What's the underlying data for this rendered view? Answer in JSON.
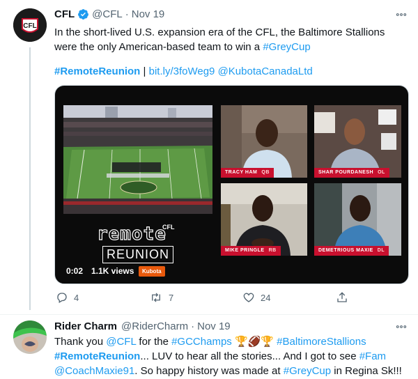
{
  "tweet1": {
    "author_name": "CFL",
    "verified": true,
    "handle": "@CFL",
    "separator": "·",
    "date": "Nov 19",
    "text_part1": "In the short-lived U.S. expansion era of the CFL, the Baltimore Stallions were the only American-based team to win a ",
    "hashtag_greycup": "#GreyCup",
    "hashtag_remote": "#RemoteReunion",
    "divider": "|",
    "link_text": "bit.ly/3foWeg9",
    "mention_kubota": "@KubotaCanadaLtd",
    "more_icon": "more-horizontal-icon",
    "video": {
      "overlay_title_top": "remote",
      "overlay_title_badge": "CFL",
      "overlay_title_bottom": "REUNION",
      "time": "0:02",
      "views": "1.1K views",
      "sponsor": "Kubota",
      "players": [
        {
          "name": "TRACY HAM",
          "position": "QB"
        },
        {
          "name": "SHAR POURDANESH",
          "position": "OL"
        },
        {
          "name": "MIKE PRINGLE",
          "position": "RB"
        },
        {
          "name": "DEMETRIOUS MAXIE",
          "position": "DL"
        }
      ]
    },
    "actions": {
      "replies": "4",
      "retweets": "7",
      "likes": "24"
    }
  },
  "tweet2": {
    "author_name": "Rider Charm",
    "handle": "@RiderCharm",
    "separator": "·",
    "date": "Nov 19",
    "line1_a": "Thank you ",
    "mention_cfl": "@CFL",
    "line1_b": " for the ",
    "hashtag_gcchamps": "#GCChamps",
    "emojis": "🏆🏈🏆",
    "hashtag_stallions": "#BaltimoreStallions",
    "hashtag_remote": "#RemoteReunion",
    "line2_b": "... LUV to hear all the stories... And I got to see ",
    "hashtag_fam": "#Fam",
    "mention_maxie": "@CoachMaxie91",
    "line3_b": ". So happy history was made at ",
    "hashtag_greycup": "#GreyCup",
    "line3_c": " in Regina Sk!!!"
  },
  "colors": {
    "link": "#1d9bf0",
    "text": "#0f1419",
    "muted": "#536471",
    "cfl_red": "#c8102e"
  }
}
